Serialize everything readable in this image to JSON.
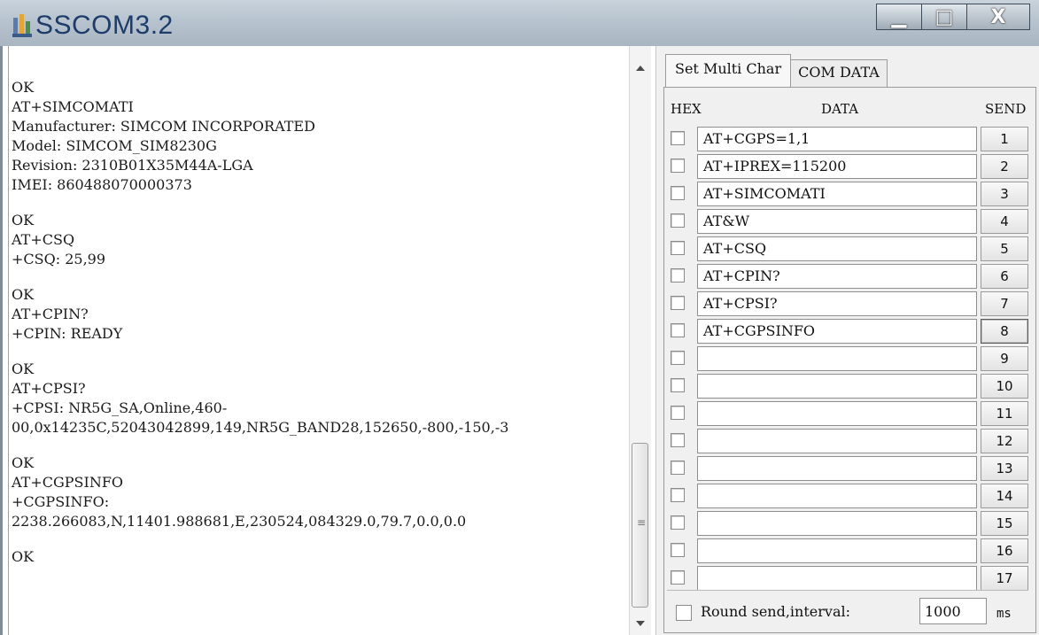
{
  "window": {
    "title": "SSCOM3.2",
    "buttons": {
      "minimize": "▁",
      "maximize": "□",
      "close": "X"
    }
  },
  "terminal": {
    "lines": [
      "OK",
      "AT+SIMCOMATI",
      "Manufacturer: SIMCOM INCORPORATED",
      "Model: SIMCOM_SIM8230G",
      "Revision: 2310B01X35M44A-LGA",
      "IMEI: 860488070000373",
      "",
      "OK",
      "AT+CSQ",
      "+CSQ: 25,99",
      "",
      "OK",
      "AT+CPIN?",
      "+CPIN: READY",
      "",
      "OK",
      "AT+CPSI?",
      "+CPSI: NR5G_SA,Online,460-",
      "00,0x14235C,52043042899,149,NR5G_BAND28,152650,-800,-150,-3",
      "",
      "OK",
      "AT+CGPSINFO",
      "+CGPSINFO:",
      "2238.266083,N,11401.988681,E,230524,084329.0,79.7,0.0,0.0",
      "",
      "OK"
    ]
  },
  "panel": {
    "tabs": [
      "Set Multi Char",
      "COM DATA"
    ],
    "active_tab": "Set Multi Char",
    "headers": {
      "hex": "HEX",
      "data": "DATA",
      "send": "SEND"
    },
    "rows": [
      {
        "data": "AT+CGPS=1,1",
        "send": "1"
      },
      {
        "data": "AT+IPREX=115200",
        "send": "2"
      },
      {
        "data": "AT+SIMCOMATI",
        "send": "3"
      },
      {
        "data": "AT&W",
        "send": "4"
      },
      {
        "data": "AT+CSQ",
        "send": "5"
      },
      {
        "data": "AT+CPIN?",
        "send": "6"
      },
      {
        "data": "AT+CPSI?",
        "send": "7"
      },
      {
        "data": "AT+CGPSINFO",
        "send": "8"
      },
      {
        "data": "",
        "send": "9"
      },
      {
        "data": "",
        "send": "10"
      },
      {
        "data": "",
        "send": "11"
      },
      {
        "data": "",
        "send": "12"
      },
      {
        "data": "",
        "send": "13"
      },
      {
        "data": "",
        "send": "14"
      },
      {
        "data": "",
        "send": "15"
      },
      {
        "data": "",
        "send": "16"
      },
      {
        "data": "",
        "send": "17"
      }
    ],
    "round_send": {
      "label": "Round send,interval:",
      "value": "1000",
      "unit": "ms"
    }
  }
}
